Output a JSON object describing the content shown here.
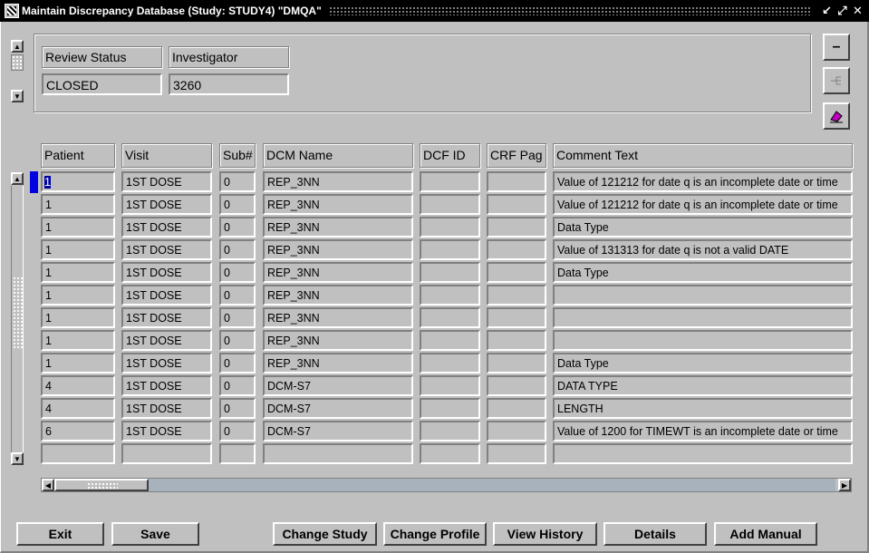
{
  "window": {
    "title": "Maintain Discrepancy Database (Study: STUDY4) \"DMQA\"",
    "controls": [
      "↙",
      "⤢",
      "✕"
    ]
  },
  "top": {
    "review_status_label": "Review Status",
    "investigator_label": "Investigator",
    "review_status_value": "CLOSED",
    "investigator_value": "3260"
  },
  "toolbar": {
    "minus_glyph": "–"
  },
  "grid": {
    "columns": [
      "Patient",
      "Visit",
      "Sub#",
      "DCM Name",
      "DCF ID",
      "CRF Pag",
      "Comment Text"
    ],
    "rows": [
      {
        "patient": "1",
        "visit": "1ST DOSE",
        "sub": "0",
        "dcm": "REP_3NN",
        "dcf": "",
        "crf": "",
        "comment": "Value of 121212 for date q is an incomplete date or time"
      },
      {
        "patient": "1",
        "visit": "1ST DOSE",
        "sub": "0",
        "dcm": "REP_3NN",
        "dcf": "",
        "crf": "",
        "comment": "Value of 121212 for date q is an incomplete date or time"
      },
      {
        "patient": "1",
        "visit": "1ST DOSE",
        "sub": "0",
        "dcm": "REP_3NN",
        "dcf": "",
        "crf": "",
        "comment": "Data Type"
      },
      {
        "patient": "1",
        "visit": "1ST DOSE",
        "sub": "0",
        "dcm": "REP_3NN",
        "dcf": "",
        "crf": "",
        "comment": "Value of 131313 for date q is not a valid DATE"
      },
      {
        "patient": "1",
        "visit": "1ST DOSE",
        "sub": "0",
        "dcm": "REP_3NN",
        "dcf": "",
        "crf": "",
        "comment": "Data Type"
      },
      {
        "patient": "1",
        "visit": "1ST DOSE",
        "sub": "0",
        "dcm": "REP_3NN",
        "dcf": "",
        "crf": "",
        "comment": ""
      },
      {
        "patient": "1",
        "visit": "1ST DOSE",
        "sub": "0",
        "dcm": "REP_3NN",
        "dcf": "",
        "crf": "",
        "comment": ""
      },
      {
        "patient": "1",
        "visit": "1ST DOSE",
        "sub": "0",
        "dcm": "REP_3NN",
        "dcf": "",
        "crf": "",
        "comment": ""
      },
      {
        "patient": "1",
        "visit": "1ST DOSE",
        "sub": "0",
        "dcm": "REP_3NN",
        "dcf": "",
        "crf": "",
        "comment": "Data Type"
      },
      {
        "patient": "4",
        "visit": "1ST DOSE",
        "sub": "0",
        "dcm": "DCM-S7",
        "dcf": "",
        "crf": "",
        "comment": "DATA TYPE"
      },
      {
        "patient": "4",
        "visit": "1ST DOSE",
        "sub": "0",
        "dcm": "DCM-S7",
        "dcf": "",
        "crf": "",
        "comment": "LENGTH"
      },
      {
        "patient": "6",
        "visit": "1ST DOSE",
        "sub": "0",
        "dcm": "DCM-S7",
        "dcf": "",
        "crf": "",
        "comment": "Value of 1200 for TIMEWT is an incomplete date or time"
      },
      {
        "patient": "",
        "visit": "",
        "sub": "",
        "dcm": "",
        "dcf": "",
        "crf": "",
        "comment": ""
      }
    ]
  },
  "buttons": {
    "exit": "Exit",
    "save": "Save",
    "change_study": "Change Study",
    "change_profile": "Change Profile",
    "view_history": "View History",
    "details": "Details",
    "add_manual": "Add Manual"
  },
  "colors": {
    "background": "#c0c0c0",
    "titlebar": "#000000",
    "selection_marker": "#0000e0"
  }
}
